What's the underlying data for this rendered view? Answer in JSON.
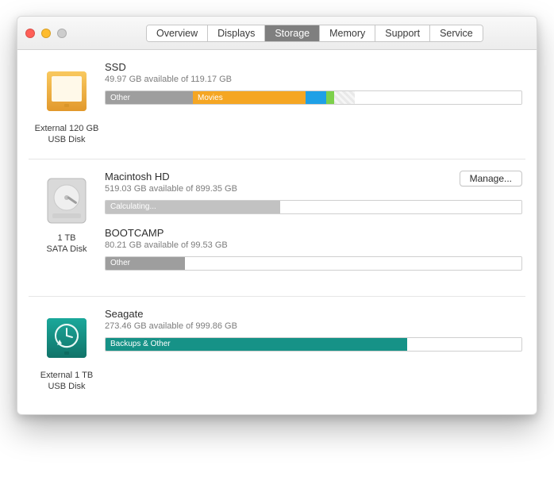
{
  "tabs": {
    "overview": "Overview",
    "displays": "Displays",
    "storage": "Storage",
    "memory": "Memory",
    "support": "Support",
    "service": "Service"
  },
  "disks": {
    "d0": {
      "caption_l1": "External 120 GB",
      "caption_l2": "USB Disk",
      "vol0": {
        "name": "SSD",
        "sub": "49.97 GB available of 119.17 GB",
        "seg_other": "Other",
        "seg_movies": "Movies"
      }
    },
    "d1": {
      "caption_l1": "1 TB",
      "caption_l2": "SATA Disk",
      "manage": "Manage...",
      "vol0": {
        "name": "Macintosh HD",
        "sub": "519.03 GB available of 899.35 GB",
        "seg_calc": "Calculating..."
      },
      "vol1": {
        "name": "BOOTCAMP",
        "sub": "80.21 GB available of 99.53 GB",
        "seg_other": "Other"
      }
    },
    "d2": {
      "caption_l1": "External 1 TB",
      "caption_l2": "USB Disk",
      "vol0": {
        "name": "Seagate",
        "sub": "273.46 GB available of 999.86 GB",
        "seg_back": "Backups & Other"
      }
    }
  }
}
